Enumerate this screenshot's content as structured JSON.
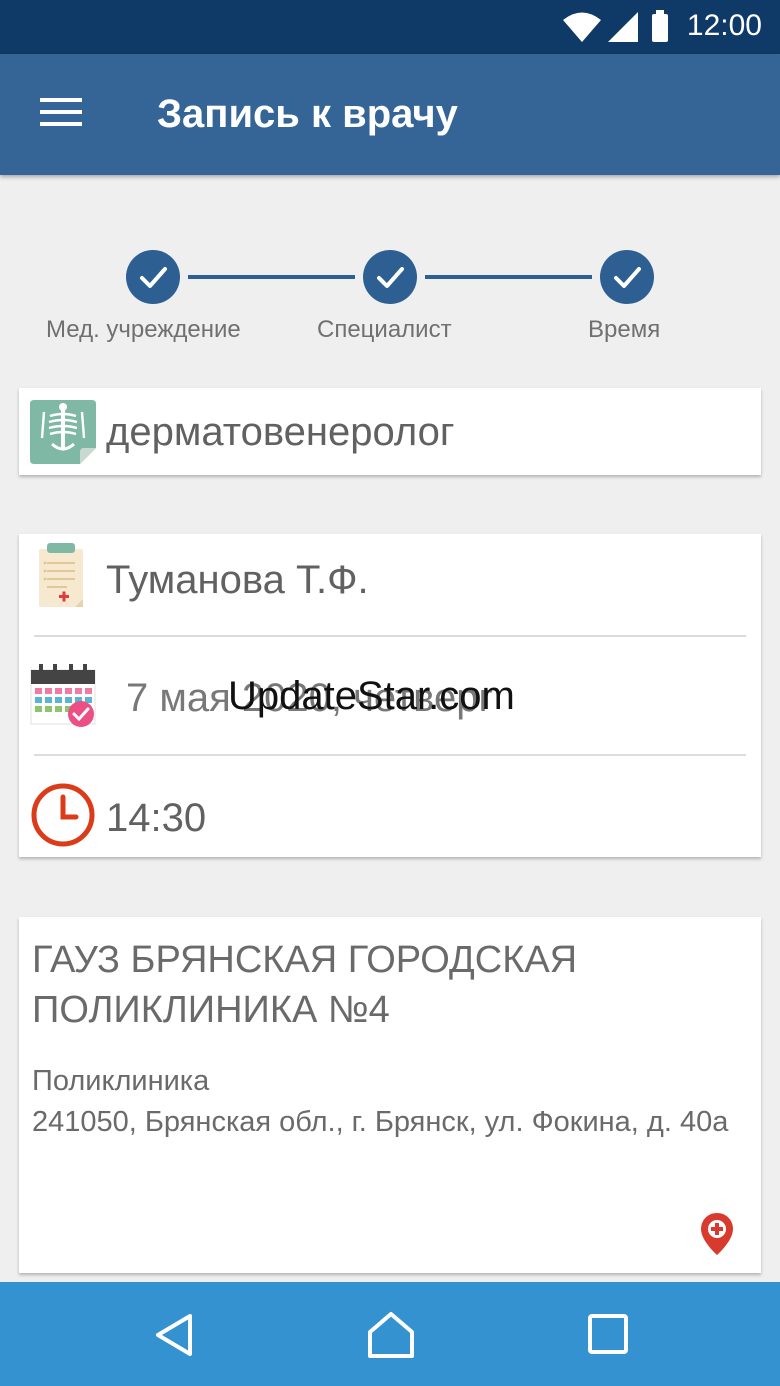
{
  "status_bar": {
    "time": "12:00",
    "icons": [
      "wifi-icon",
      "signal-icon",
      "battery-icon"
    ]
  },
  "app_bar": {
    "title": "Запись к врачу",
    "menu_icon": "hamburger-menu-icon"
  },
  "stepper": {
    "steps": [
      {
        "label": "Мед. учреждение",
        "done": true
      },
      {
        "label": "Специалист",
        "done": true
      },
      {
        "label": "Время",
        "done": true
      }
    ]
  },
  "specialty_card": {
    "specialty": "дерматовенеролог",
    "icon": "xray-icon"
  },
  "appointment_card": {
    "doctor": "Туманова Т.Ф.",
    "date": "7 мая 2020, четверг",
    "time": "14:30",
    "icons": [
      "medical-record-icon",
      "calendar-icon",
      "clock-icon"
    ]
  },
  "watermark": "UpdateStar.com",
  "clinic_card": {
    "name": "ГАУЗ БРЯНСКАЯ ГОРОДСКАЯ ПОЛИКЛИНИКА №4",
    "type": "Поликлиника",
    "address": "241050, Брянская обл., г. Брянск, ул. Фокина, д. 40а",
    "icon": "map-pin-icon"
  },
  "nav_bar": {
    "buttons": [
      "back-icon",
      "home-icon",
      "recents-icon"
    ]
  },
  "colors": {
    "status_bar": "#0f3a68",
    "app_bar": "#346596",
    "accent": "#2d5f92",
    "nav_bar": "#3592d0",
    "clock": "#dc3b1a",
    "pin": "#d93a2e"
  }
}
